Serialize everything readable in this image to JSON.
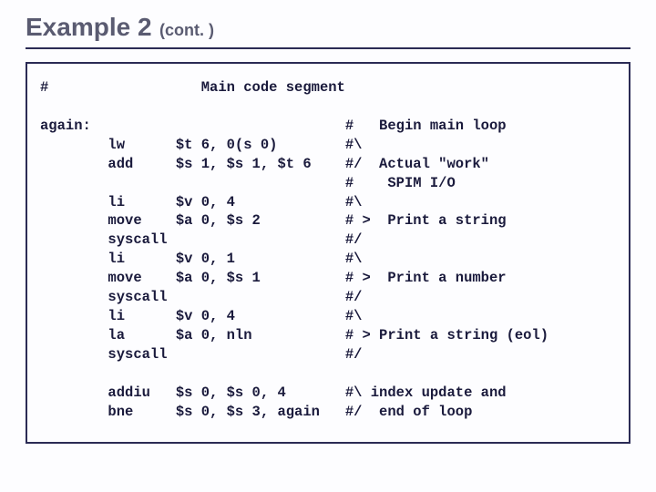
{
  "header": {
    "title": "Example 2",
    "subtitle": "(cont. )"
  },
  "code": {
    "lines": [
      "#                  Main code segment",
      "",
      "again:                              #   Begin main loop",
      "        lw      $t 6, 0(s 0)        #\\",
      "        add     $s 1, $s 1, $t 6    #/  Actual \"work\"",
      "                                    #    SPIM I/O",
      "        li      $v 0, 4             #\\",
      "        move    $a 0, $s 2          # >  Print a string",
      "        syscall                     #/",
      "        li      $v 0, 1             #\\",
      "        move    $a 0, $s 1          # >  Print a number",
      "        syscall                     #/",
      "        li      $v 0, 4             #\\",
      "        la      $a 0, nln           # > Print a string (eol)",
      "        syscall                     #/",
      "",
      "        addiu   $s 0, $s 0, 4       #\\ index update and",
      "        bne     $s 0, $s 3, again   #/  end of loop"
    ]
  }
}
